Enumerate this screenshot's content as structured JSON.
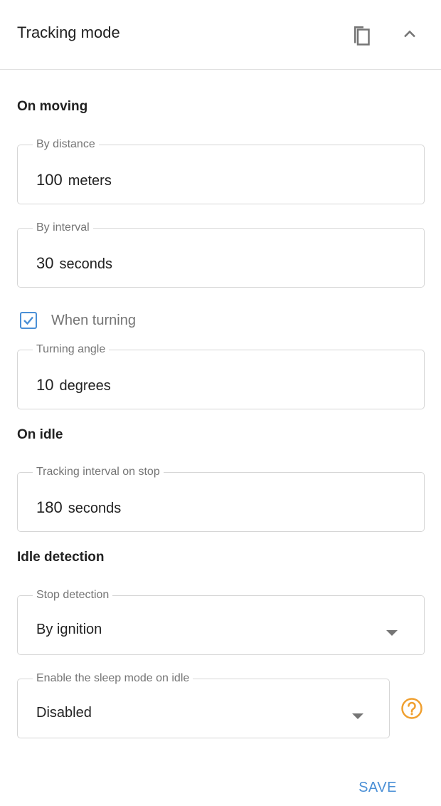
{
  "header": {
    "title": "Tracking mode"
  },
  "sections": {
    "on_moving": "On moving",
    "on_idle": "On idle",
    "idle_detection": "Idle detection"
  },
  "fields": {
    "by_distance": {
      "label": "By distance",
      "value": "100",
      "unit": "meters"
    },
    "by_interval": {
      "label": "By interval",
      "value": "30",
      "unit": "seconds"
    },
    "turning_angle": {
      "label": "Turning angle",
      "value": "10",
      "unit": "degrees"
    },
    "tracking_interval_on_stop": {
      "label": "Tracking interval on stop",
      "value": "180",
      "unit": "seconds"
    },
    "stop_detection": {
      "label": "Stop detection",
      "selected": "By ignition"
    },
    "sleep_mode": {
      "label": "Enable the sleep mode on idle",
      "selected": "Disabled"
    }
  },
  "when_turning": {
    "label": "When turning",
    "checked": true
  },
  "icons": {
    "copy": "copy-icon",
    "collapse": "chevron-up-icon",
    "help": "help-circle-icon",
    "dropdown": "dropdown-arrow-icon"
  },
  "colors": {
    "accent": "#4a8fd6",
    "help": "#f0a030",
    "border": "#d6d6d6",
    "muted_text": "#757575"
  },
  "actions": {
    "save_label": "SAVE"
  }
}
